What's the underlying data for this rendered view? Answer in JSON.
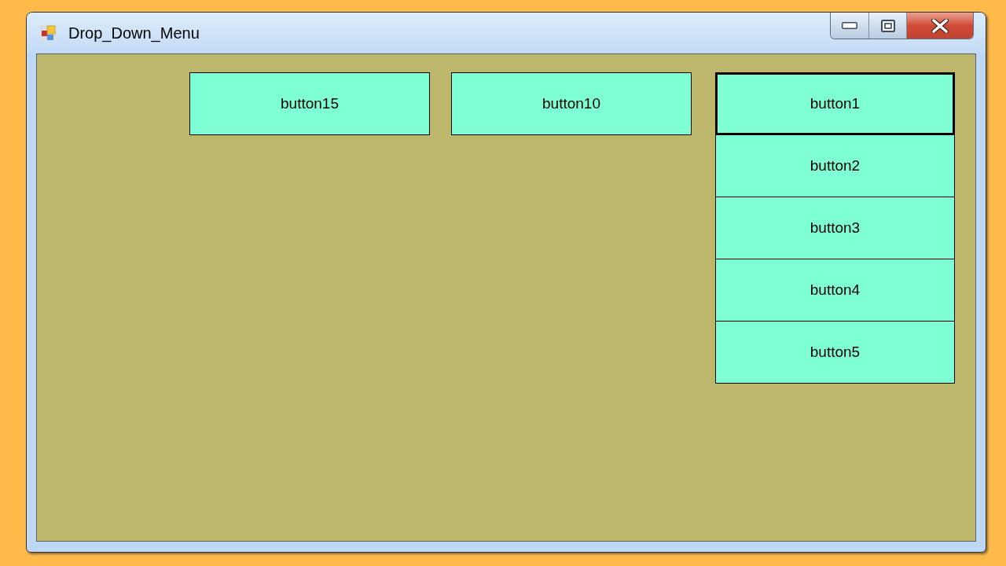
{
  "window": {
    "title": "Drop_Down_Menu"
  },
  "buttons": [
    {
      "label": "button15"
    },
    {
      "label": "button10"
    }
  ],
  "dropdown": {
    "items": [
      {
        "label": "button1",
        "focused": true
      },
      {
        "label": "button2",
        "focused": false
      },
      {
        "label": "button3",
        "focused": false
      },
      {
        "label": "button4",
        "focused": false
      },
      {
        "label": "button5",
        "focused": false
      }
    ]
  }
}
